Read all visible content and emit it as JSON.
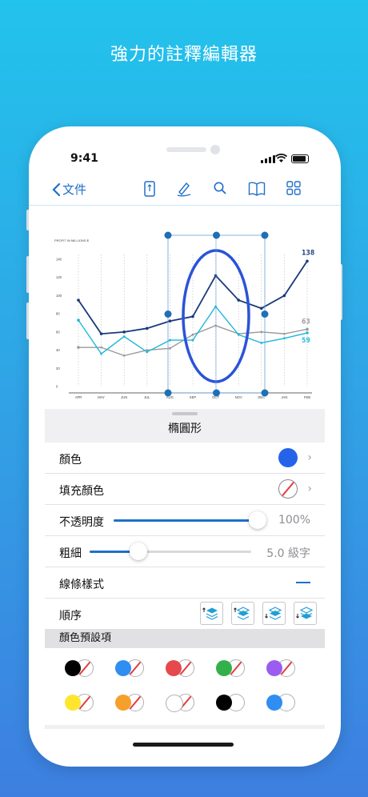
{
  "headline": "強力的註釋編輯器",
  "status_bar": {
    "time": "9:41"
  },
  "navbar": {
    "back_label": "文件",
    "icons": [
      "page-icon",
      "pen-icon",
      "search-icon",
      "book-icon",
      "grid-icon"
    ]
  },
  "chart_data": {
    "type": "line",
    "ylabel": "PROFIT IN MILLIONS $",
    "categories": [
      "APR",
      "MAY",
      "JUN",
      "JUL",
      "AUG",
      "SEP",
      "OCT",
      "NOV",
      "DEC",
      "JAN",
      "FEB"
    ],
    "y_ticks": [
      "140",
      "120",
      "100",
      "80",
      "60",
      "40",
      "20",
      "0"
    ],
    "ylim": [
      0,
      140
    ],
    "series": [
      {
        "color": "#1a3a7a",
        "values": [
          95,
          58,
          60,
          64,
          72,
          77,
          122,
          95,
          86,
          100,
          138
        ],
        "end_label": "138"
      },
      {
        "color": "#9a9a9a",
        "values": [
          43,
          43,
          34,
          40,
          42,
          57,
          67,
          58,
          60,
          58,
          63
        ],
        "end_label": "63"
      },
      {
        "color": "#1fb8d8",
        "values": [
          73,
          36,
          55,
          38,
          51,
          51,
          88,
          57,
          48,
          53,
          59
        ],
        "end_label": "59"
      }
    ],
    "grid": true
  },
  "annotation": {
    "shape": "ellipse",
    "stroke_color": "#2b53d9"
  },
  "panel": {
    "title": "橢圓形",
    "color_label": "顏色",
    "color_value": "#2563eb",
    "fill_label": "填充顏色",
    "opacity_label": "不透明度",
    "opacity_value": "100%",
    "opacity_fraction": 1.0,
    "thickness_label": "粗細",
    "thickness_value": "5.0 級字",
    "thickness_fraction": 0.3,
    "line_style_label": "線條樣式",
    "order_label": "順序",
    "presets_header": "顏色預設項",
    "presets": [
      {
        "color": "#000000",
        "fill": "none"
      },
      {
        "color": "#2f8ef0",
        "fill": "none"
      },
      {
        "color": "#e5484d",
        "fill": "none"
      },
      {
        "color": "#34b04a",
        "fill": "none"
      },
      {
        "color": "#9b5cf0",
        "fill": "none"
      },
      {
        "color": "#ffe62e",
        "fill": "none"
      },
      {
        "color": "#f5a02a",
        "fill": "none"
      },
      {
        "color": "#ffffff",
        "fill": "none"
      },
      {
        "color": "#000000",
        "fill": "#ffffff"
      },
      {
        "color": "#2f8ef0",
        "fill": "#ffffff"
      }
    ]
  }
}
